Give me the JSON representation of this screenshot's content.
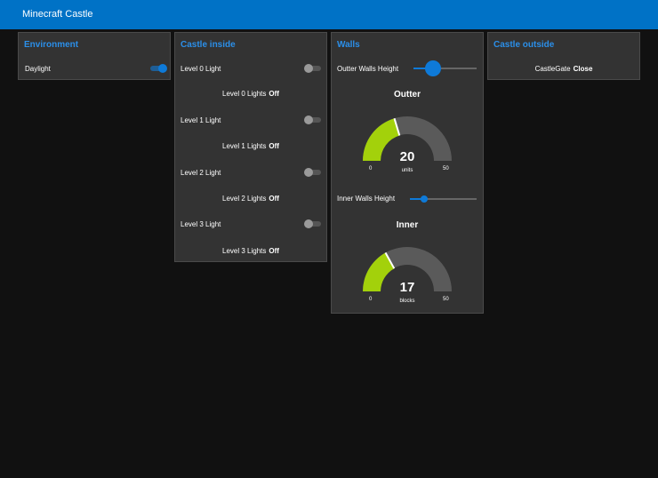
{
  "app": {
    "title": "Minecraft Castle"
  },
  "environment": {
    "title": "Environment",
    "daylight_label": "Daylight",
    "daylight_on": true
  },
  "castle_inside": {
    "title": "Castle inside",
    "levels": [
      {
        "switch_label": "Level 0 Light",
        "status_label": "Level 0 Lights",
        "status": "Off",
        "on": false
      },
      {
        "switch_label": "Level 1 Light",
        "status_label": "Level 1 Lights",
        "status": "Off",
        "on": false
      },
      {
        "switch_label": "Level 2 Light",
        "status_label": "Level 2 Lights",
        "status": "Off",
        "on": false
      },
      {
        "switch_label": "Level 3 Light",
        "status_label": "Level 3 Lights",
        "status": "Off",
        "on": false
      }
    ]
  },
  "walls": {
    "title": "Walls",
    "outer_slider_label": "Outter Walls Height",
    "inner_slider_label": "Inner Walls Height",
    "outer_gauge": {
      "title": "Outter",
      "value": "20",
      "unit": "units",
      "min": "0",
      "max": "50"
    },
    "inner_gauge": {
      "title": "Inner",
      "value": "17",
      "unit": "blocks",
      "min": "0",
      "max": "50"
    },
    "gauge_fill_color": "#a3d10b",
    "gauge_track_color": "#5a5a5a"
  },
  "castle_outside": {
    "title": "Castle outside",
    "gate_label": "CastleGate",
    "gate_status": "Close"
  },
  "colors": {
    "header": "#0072c6",
    "accent": "#2b8fe9",
    "card": "#333333",
    "background": "#111111"
  }
}
